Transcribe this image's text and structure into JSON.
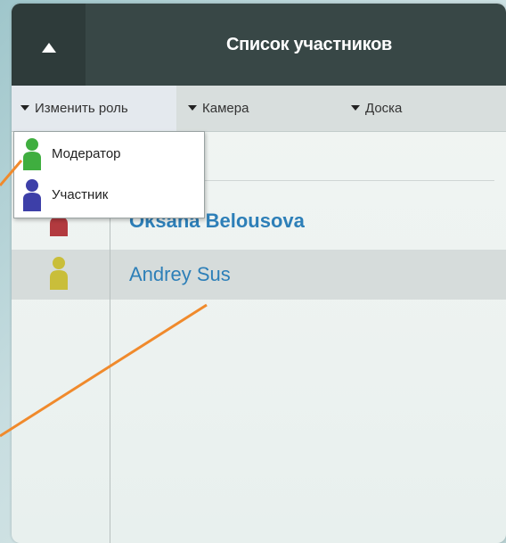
{
  "header": {
    "title": "Список участников",
    "collapse_icon": "triangle-up-icon"
  },
  "toolbar": {
    "items": [
      {
        "label": "Изменить роль",
        "icon": "caret-down-icon",
        "active": true
      },
      {
        "label": "Камера",
        "icon": "caret-down-icon",
        "active": false
      },
      {
        "label": "Доска",
        "icon": "caret-down-icon",
        "active": false
      }
    ]
  },
  "role_menu": {
    "items": [
      {
        "label": "Модератор",
        "icon": "person-icon",
        "color": "#3fae3f"
      },
      {
        "label": "Участник",
        "icon": "person-icon",
        "color": "#3d3fa8"
      }
    ]
  },
  "participants": [
    {
      "name": "Oksana Belousova",
      "icon": "person-icon",
      "color": "#b23a3f",
      "selected": false,
      "bold": true
    },
    {
      "name": "Andrey Sus",
      "icon": "person-icon",
      "color": "#c9be3a",
      "selected": true,
      "bold": false
    }
  ],
  "colors": {
    "header_bg": "#384746",
    "name_link": "#2d7fb8",
    "annotation_line": "#f08a2c"
  }
}
